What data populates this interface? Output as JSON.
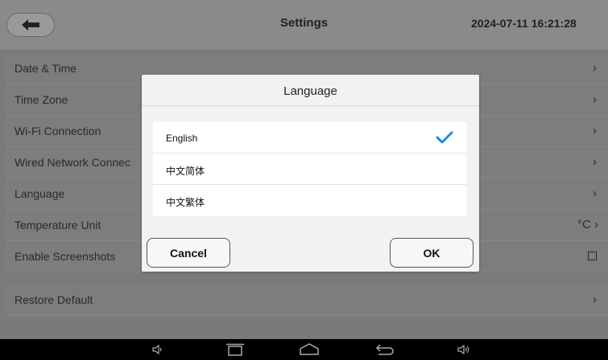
{
  "header": {
    "title": "Settings",
    "datetime": "2024-07-11 16:21:28"
  },
  "settings": {
    "items": [
      {
        "label": "Date & Time",
        "trail": "›"
      },
      {
        "label": "Time Zone",
        "trail": "›"
      },
      {
        "label": "Wi-Fi Connection",
        "trail": "›"
      },
      {
        "label": "Wired Network Connec",
        "trail": "›"
      },
      {
        "label": "Language",
        "trail": "›"
      },
      {
        "label": "Temperature Unit",
        "trail": "°C ›"
      },
      {
        "label": "Enable Screenshots",
        "trail": ""
      },
      {
        "label": "Restore Default",
        "trail": "›"
      }
    ]
  },
  "dialog": {
    "title": "Language",
    "options": [
      {
        "label": "English",
        "selected": true
      },
      {
        "label": "中文简体",
        "selected": false
      },
      {
        "label": "中文繁体",
        "selected": false
      }
    ],
    "cancel_label": "Cancel",
    "ok_label": "OK"
  },
  "colors": {
    "accent": "#1e88e5",
    "overlay": "#7a7a7a",
    "navbar": "#000000"
  },
  "icons": {
    "back": "back-arrow-icon",
    "check": "checkmark-icon",
    "nav": [
      "volume-down-icon",
      "recent-apps-icon",
      "home-icon",
      "back-icon",
      "volume-up-icon"
    ]
  }
}
